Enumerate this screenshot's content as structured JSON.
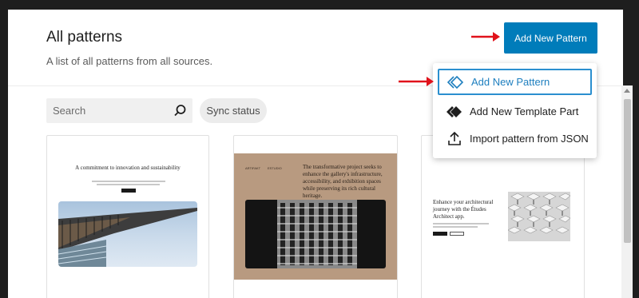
{
  "header": {
    "title": "All patterns",
    "subtitle": "A list of all patterns from all sources.",
    "add_button_label": "Add New Pattern"
  },
  "filters": {
    "search_placeholder": "Search",
    "sync_status_label": "Sync status"
  },
  "dropdown": {
    "items": [
      {
        "label": "Add New Pattern",
        "icon": "pattern-icon"
      },
      {
        "label": "Add New Template Part",
        "icon": "template-part-icon"
      },
      {
        "label": "Import pattern from JSON",
        "icon": "upload-icon"
      }
    ]
  },
  "cards": [
    {
      "heading": "A commitment to innovation and sustainability"
    },
    {
      "tiny_left": "ARTIFAKT",
      "tiny_right": "ESTUDIO",
      "heading": "The transformative project seeks to enhance the gallery's infrastructure, accessibility, and exhibition spaces while preserving its rich cultural heritage."
    },
    {
      "heading": "Enhance your architectural journey with the Études Architect app."
    }
  ],
  "colors": {
    "accent": "#007cba",
    "annotation_arrow": "#e0121b",
    "card2_background": "#b89a80"
  }
}
